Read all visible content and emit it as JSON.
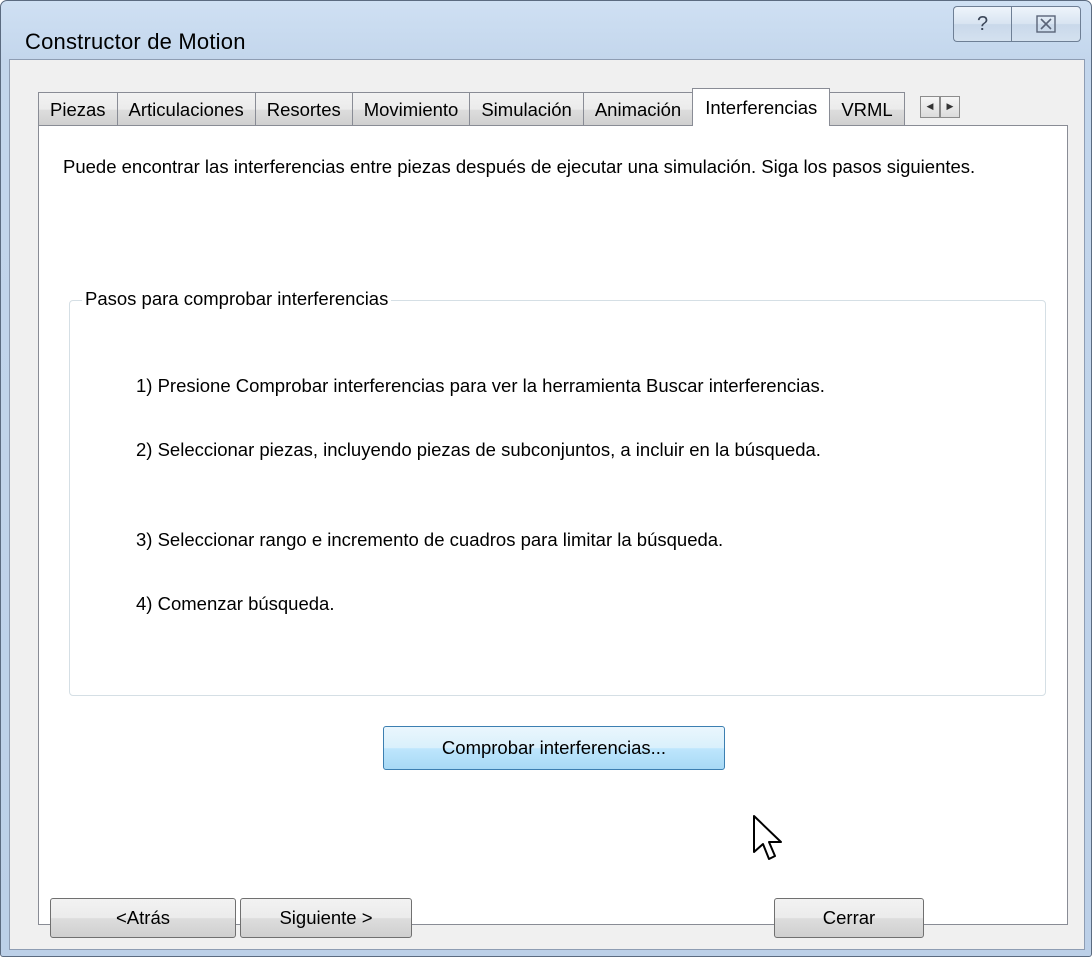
{
  "window": {
    "title": "Constructor de Motion",
    "help_glyph": "?",
    "close_glyph": "⊠"
  },
  "tabs": [
    {
      "label": "Piezas",
      "active": false
    },
    {
      "label": "Articulaciones",
      "active": false
    },
    {
      "label": "Resortes",
      "active": false
    },
    {
      "label": "Movimiento",
      "active": false
    },
    {
      "label": "Simulación",
      "active": false
    },
    {
      "label": "Animación",
      "active": false
    },
    {
      "label": "Interferencias",
      "active": true
    },
    {
      "label": "VRML",
      "active": false
    }
  ],
  "tab_scroll": {
    "left_glyph": "◀",
    "right_glyph": "▶"
  },
  "page": {
    "intro": "Puede encontrar las interferencias entre piezas después de ejecutar una simulación. Siga los pasos siguientes.",
    "group_title": "Pasos para comprobar interferencias",
    "steps": [
      "1) Presione Comprobar interferencias para ver la herramienta Buscar interferencias.",
      "2) Seleccionar piezas, incluyendo piezas de subconjuntos, a incluir en la búsqueda.",
      "3) Seleccionar rango e incremento de cuadros para limitar la búsqueda.",
      "4) Comenzar búsqueda."
    ],
    "check_button": "Comprobar interferencias..."
  },
  "footer": {
    "back_label": "<Atrás",
    "next_label": "Siguiente >",
    "close_label": "Cerrar"
  },
  "colors": {
    "frame": "#c3d6ec",
    "client": "#f0f0f0",
    "page": "#ffffff",
    "hover_button": "#bee6fd"
  }
}
